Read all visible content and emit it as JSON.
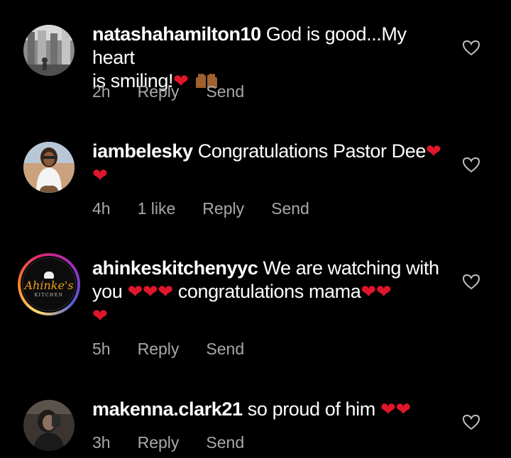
{
  "comments": [
    {
      "username": "natashahamilton10",
      "text_line1": "God is good...My heart",
      "text_line2": "is smiling!",
      "heart": "❤",
      "time": "2h",
      "likes": "",
      "reply": "Reply",
      "send": "Send"
    },
    {
      "username": "iambelesky",
      "text_line1": "Congratulations Pastor Dee",
      "heart": "❤",
      "time": "4h",
      "likes": "1 like",
      "reply": "Reply",
      "send": "Send"
    },
    {
      "username": "ahinkeskitchenyyc",
      "text_line1": "We are watching with",
      "text_line2a": "you",
      "text_line2b": "congratulations mama",
      "heart": "❤",
      "time": "5h",
      "likes": "",
      "reply": "Reply",
      "send": "Send",
      "logo_brand": "Ahinke's",
      "logo_sub": "KITCHEN"
    },
    {
      "username": "makenna.clark21",
      "text_line1": "so proud of him",
      "heart": "❤",
      "time": "3h",
      "likes": "",
      "reply": "Reply",
      "send": "Send"
    }
  ],
  "colors": {
    "background": "#000000",
    "text": "#ffffff",
    "meta": "#a8a8a8",
    "heart": "#e0162b"
  }
}
